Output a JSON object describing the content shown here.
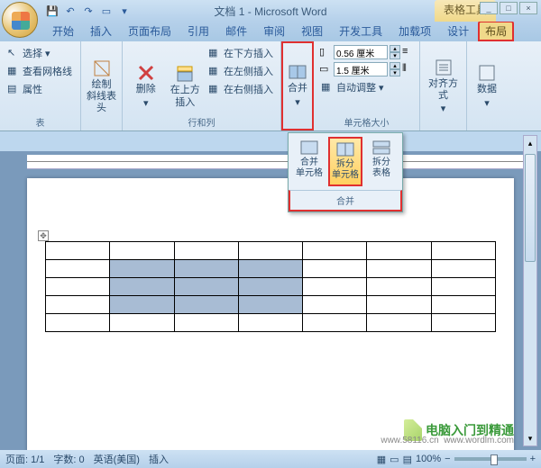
{
  "title": "文档 1 - Microsoft Word",
  "table_tools": "表格工具",
  "tabs": [
    "开始",
    "插入",
    "页面布局",
    "引用",
    "邮件",
    "审阅",
    "视图",
    "开发工具",
    "加载项",
    "设计",
    "布局"
  ],
  "active_tab_index": 10,
  "ribbon": {
    "group_table": {
      "label": "表",
      "select": "选择",
      "gridlines": "查看网格线",
      "properties": "属性"
    },
    "group_draw": {
      "draw_erase": "绘制\n斜线表头"
    },
    "group_rowscols": {
      "label": "行和列",
      "delete": "删除",
      "insert_above": "在上方\n插入",
      "insert_below": "在下方插入",
      "insert_left": "在左侧插入",
      "insert_right": "在右侧插入"
    },
    "group_merge": {
      "label": "合并",
      "merge": "合并"
    },
    "group_cellsize": {
      "label": "单元格大小",
      "height": "0.56 厘米",
      "width": "1.5 厘米",
      "autofit": "自动调整"
    },
    "group_align": {
      "label": "对齐方式"
    },
    "group_data": {
      "label": "数据"
    }
  },
  "popup": {
    "items": [
      {
        "label": "合并\n单元格",
        "name": "merge-cells"
      },
      {
        "label": "拆分\n单元格",
        "name": "split-cells"
      },
      {
        "label": "拆分\n表格",
        "name": "split-table"
      }
    ],
    "footer": "合并",
    "selected_index": 1
  },
  "table": {
    "rows": 5,
    "cols": 7,
    "selection": {
      "r0": 1,
      "r1": 3,
      "c0": 1,
      "c1": 3
    }
  },
  "statusbar": {
    "page": "页面: 1/1",
    "words": "字数: 0",
    "lang": "英语(美国)",
    "mode": "插入",
    "zoom": "100%"
  },
  "watermark": {
    "text": "电脑入门到精通",
    "url1": "www.58116.cn",
    "url2": "www.wordlm.com"
  },
  "colors": {
    "highlight": "#e03030"
  }
}
